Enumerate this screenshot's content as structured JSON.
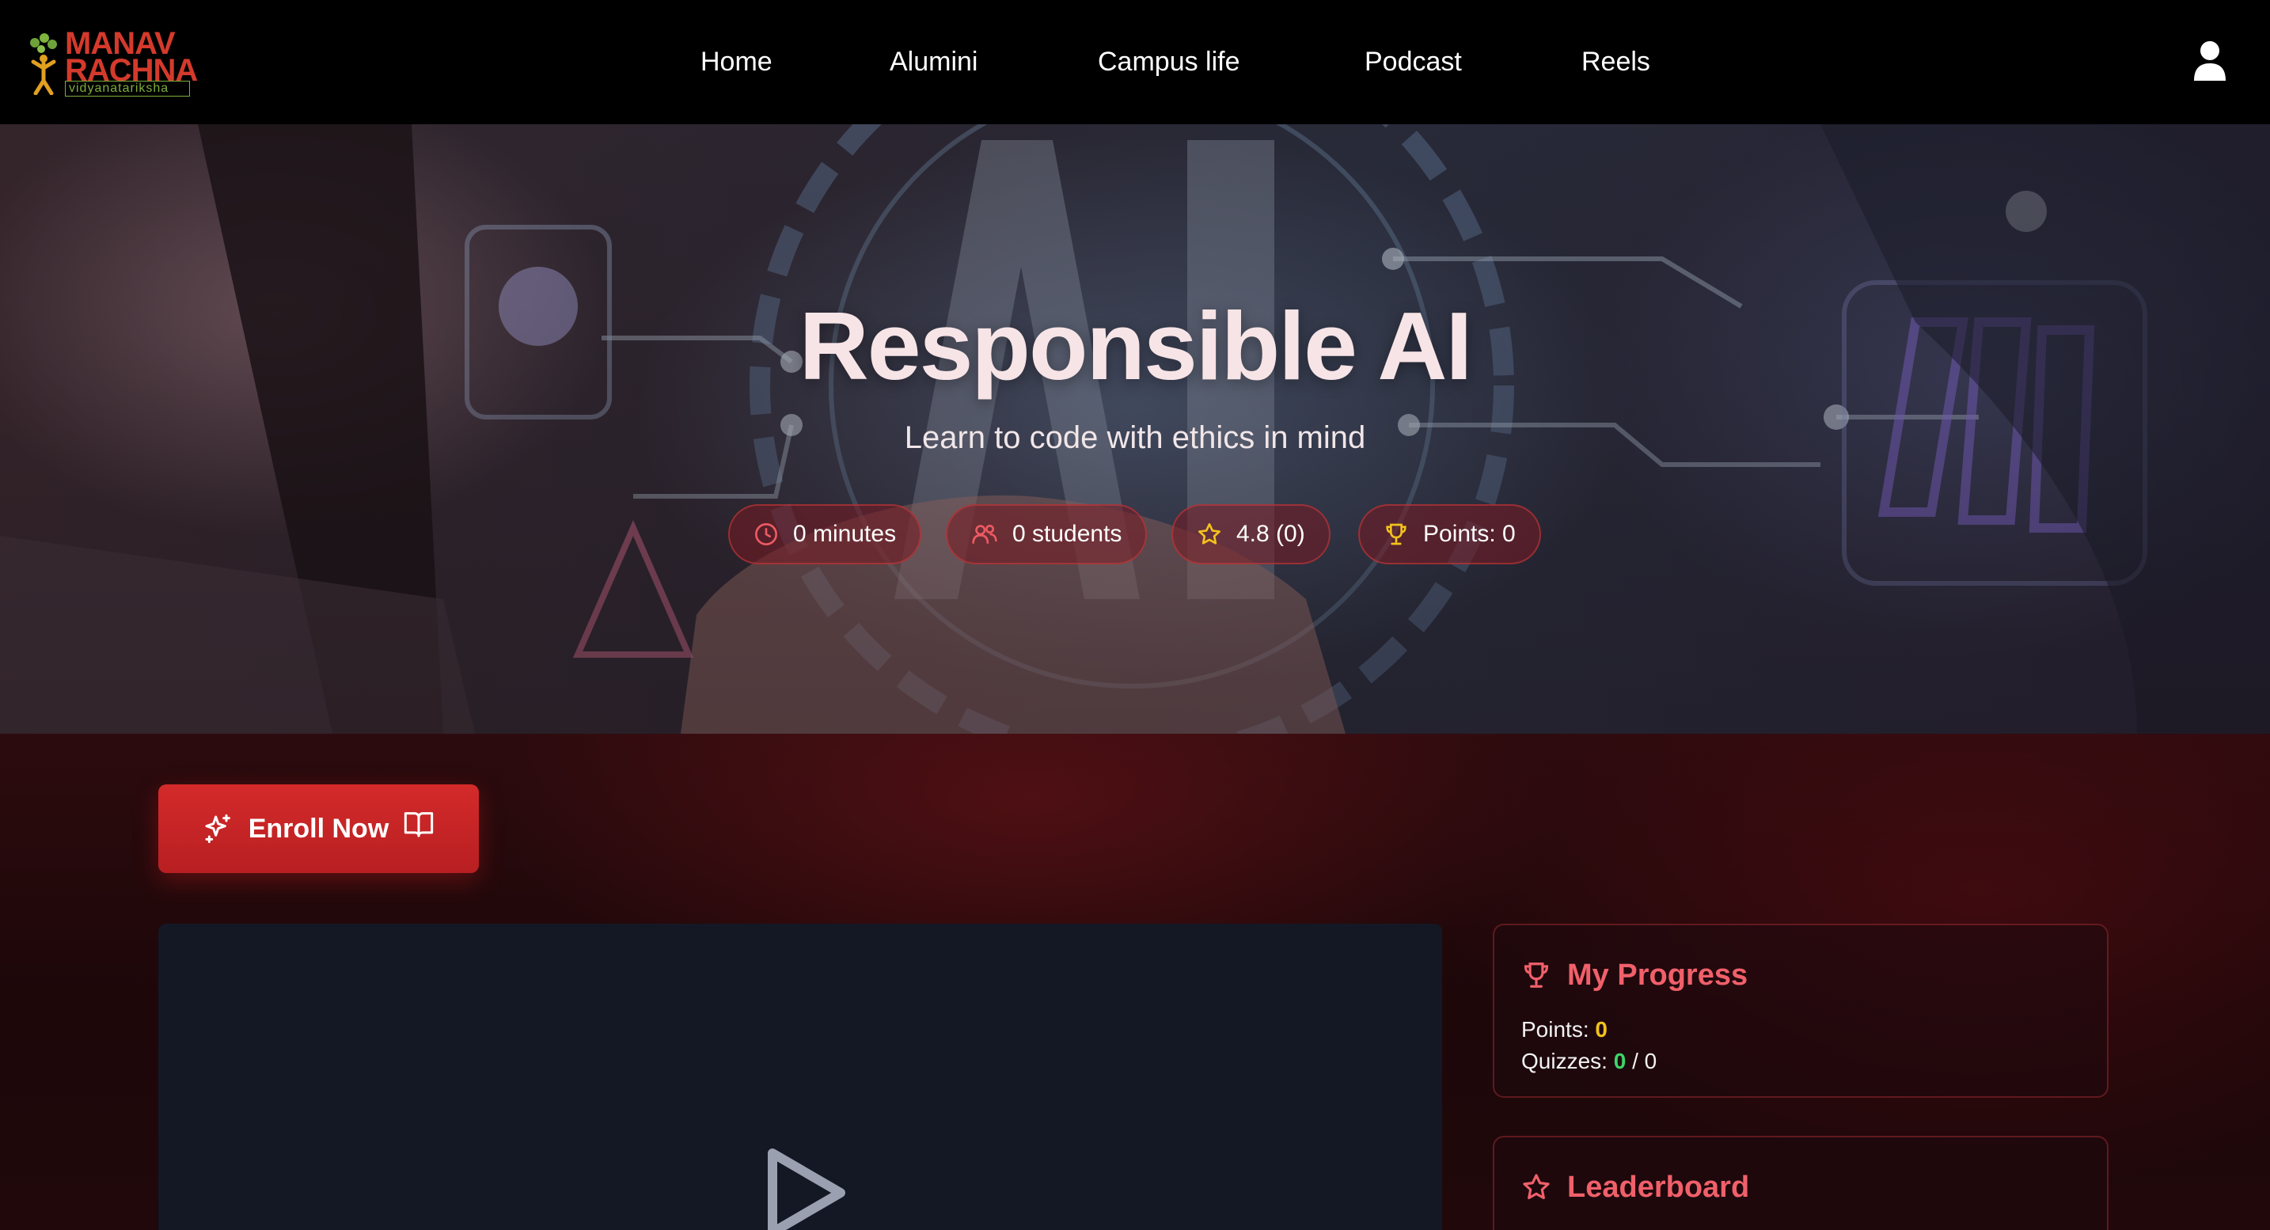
{
  "brand": {
    "logo_line1": "MANAV",
    "logo_line2": "RACHNA",
    "logo_tagline": "vidyanatariksha",
    "logo_color": "#d43a2c",
    "tagline_color": "#7fae3c"
  },
  "nav": {
    "items": [
      "Home",
      "Alumini",
      "Campus life",
      "Podcast",
      "Reels"
    ],
    "user_icon": "user-icon"
  },
  "hero": {
    "title": "Responsible AI",
    "subtitle": "Learn to code with ethics in mind",
    "stats": [
      {
        "icon": "clock-icon",
        "label": "0 minutes"
      },
      {
        "icon": "users-icon",
        "label": "0 students"
      },
      {
        "icon": "star-icon",
        "label": "4.8 (0)"
      },
      {
        "icon": "trophy-icon",
        "label": "Points: 0"
      }
    ]
  },
  "enroll": {
    "label": "Enroll Now",
    "accent": "#d42a2a"
  },
  "video": {
    "icon": "play-icon"
  },
  "progress": {
    "title": "My Progress",
    "points_label": "Points:",
    "points_value": "0",
    "quizzes_label": "Quizzes:",
    "quizzes_done": "0",
    "quizzes_sep": "/",
    "quizzes_total": "0"
  },
  "leaderboard": {
    "title": "Leaderboard"
  },
  "colors": {
    "card_title": "#f0606a",
    "points_value": "#f2c21c",
    "quizzes_done": "#3ed46a"
  }
}
